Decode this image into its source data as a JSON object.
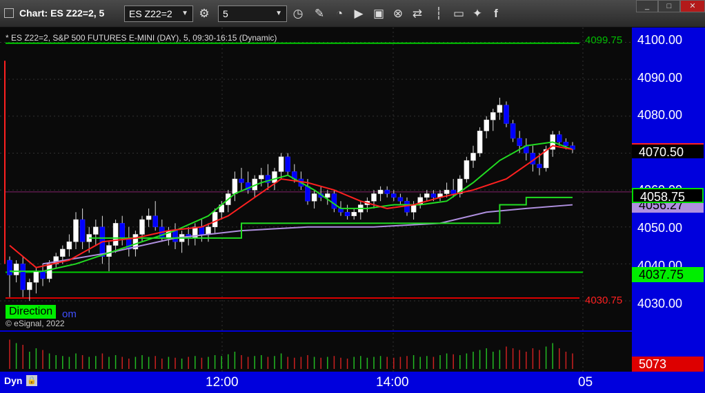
{
  "window": {
    "title": "Chart: ES Z22=2, 5",
    "symbol_value": "ES Z22=2",
    "interval_value": "5",
    "btn_minimize": "_",
    "btn_maximize": "□",
    "btn_close": "✕"
  },
  "toolbar": {
    "icons": [
      "settings-icon",
      "clock-icon",
      "pencil-icon",
      "chart-line-icon",
      "play-icon",
      "text-box-icon",
      "target-icon",
      "swap-icon",
      "bar-icon",
      "comment-icon",
      "twitter-icon",
      "facebook-icon"
    ]
  },
  "chart": {
    "header": "* ES Z22=2, S&P 500 FUTURES E-MINI (DAY), 5, 09:30-16:15 (Dynamic)",
    "level_top": "4099.75",
    "level_bottom": "4030.75",
    "direction_label": "Direction",
    "fragment_text": "om",
    "copyright": "© eSignal, 2022",
    "price_labels": [
      "4100.00",
      "4090.00",
      "4080.00",
      "4070.50",
      "4060.00",
      "4050.00",
      "4040.00",
      "4030.00"
    ],
    "tag_last": "4070.50",
    "tag_green": "4058.75",
    "tag_purple": "4056.27",
    "tag_direction": "4037.75",
    "volume_tag": "5073",
    "bottom_left": "Dyn",
    "time_labels": [
      "12:00",
      "14:00",
      "05"
    ]
  },
  "colors": {
    "price_axis": "#0000dd",
    "up_candle": "#ffffff",
    "down_candle": "#0000ff",
    "ma_red": "#ff2020",
    "ma_green": "#22dd22",
    "ma_purple": "#b090e0",
    "level_green": "#00cc00",
    "level_red": "#dd0000"
  },
  "chart_data": {
    "type": "candlestick",
    "ylim": [
      4022,
      4104
    ],
    "candles": [
      [
        4041,
        4042,
        4031,
        4037
      ],
      [
        4037,
        4041,
        4035,
        4040
      ],
      [
        4040,
        4042,
        4031,
        4033
      ],
      [
        4033,
        4036,
        4030,
        4035
      ],
      [
        4035,
        4039,
        4032,
        4038
      ],
      [
        4038,
        4040,
        4034,
        4036
      ],
      [
        4036,
        4041,
        4035,
        4040
      ],
      [
        4040,
        4043,
        4039,
        4042
      ],
      [
        4042,
        4045,
        4040,
        4044
      ],
      [
        4044,
        4048,
        4042,
        4046
      ],
      [
        4046,
        4054,
        4044,
        4052
      ],
      [
        4052,
        4055,
        4044,
        4046
      ],
      [
        4046,
        4050,
        4043,
        4048
      ],
      [
        4048,
        4052,
        4045,
        4050
      ],
      [
        4050,
        4053,
        4040,
        4042
      ],
      [
        4042,
        4046,
        4038,
        4045
      ],
      [
        4045,
        4052,
        4043,
        4051
      ],
      [
        4051,
        4053,
        4045,
        4047
      ],
      [
        4047,
        4050,
        4042,
        4044
      ],
      [
        4044,
        4049,
        4042,
        4048
      ],
      [
        4048,
        4053,
        4046,
        4052
      ],
      [
        4052,
        4055,
        4050,
        4053
      ],
      [
        4053,
        4057,
        4049,
        4050
      ],
      [
        4050,
        4052,
        4046,
        4047
      ],
      [
        4047,
        4050,
        4045,
        4049
      ],
      [
        4049,
        4051,
        4044,
        4046
      ],
      [
        4046,
        4049,
        4043,
        4048
      ],
      [
        4048,
        4050,
        4045,
        4047
      ],
      [
        4047,
        4051,
        4045,
        4050
      ],
      [
        4050,
        4052,
        4046,
        4048
      ],
      [
        4048,
        4051,
        4046,
        4050
      ],
      [
        4050,
        4055,
        4048,
        4054
      ],
      [
        4054,
        4057,
        4052,
        4056
      ],
      [
        4056,
        4060,
        4054,
        4059
      ],
      [
        4059,
        4065,
        4057,
        4063
      ],
      [
        4063,
        4066,
        4060,
        4062
      ],
      [
        4062,
        4065,
        4059,
        4060
      ],
      [
        4060,
        4064,
        4058,
        4063
      ],
      [
        4063,
        4066,
        4061,
        4064
      ],
      [
        4064,
        4067,
        4060,
        4062
      ],
      [
        4062,
        4066,
        4060,
        4065
      ],
      [
        4065,
        4070,
        4063,
        4069
      ],
      [
        4069,
        4070,
        4064,
        4065
      ],
      [
        4065,
        4067,
        4062,
        4063
      ],
      [
        4063,
        4065,
        4060,
        4061
      ],
      [
        4061,
        4063,
        4056,
        4057
      ],
      [
        4057,
        4060,
        4055,
        4059
      ],
      [
        4059,
        4061,
        4057,
        4058
      ],
      [
        4058,
        4060,
        4056,
        4059
      ],
      [
        4059,
        4060,
        4054,
        4055
      ],
      [
        4055,
        4057,
        4053,
        4054
      ],
      [
        4054,
        4056,
        4052,
        4053
      ],
      [
        4053,
        4055,
        4052,
        4054
      ],
      [
        4054,
        4057,
        4052,
        4056
      ],
      [
        4056,
        4058,
        4054,
        4057
      ],
      [
        4057,
        4060,
        4055,
        4059
      ],
      [
        4059,
        4061,
        4057,
        4060
      ],
      [
        4060,
        4061,
        4058,
        4059
      ],
      [
        4059,
        4060,
        4057,
        4058
      ],
      [
        4058,
        4059,
        4056,
        4057
      ],
      [
        4057,
        4058,
        4053,
        4054
      ],
      [
        4054,
        4057,
        4052,
        4056
      ],
      [
        4056,
        4059,
        4055,
        4058
      ],
      [
        4058,
        4060,
        4057,
        4059
      ],
      [
        4059,
        4060,
        4057,
        4058
      ],
      [
        4058,
        4060,
        4057,
        4059
      ],
      [
        4059,
        4062,
        4058,
        4060
      ],
      [
        4060,
        4063,
        4058,
        4059
      ],
      [
        4059,
        4064,
        4058,
        4063
      ],
      [
        4063,
        4069,
        4062,
        4068
      ],
      [
        4068,
        4072,
        4066,
        4070
      ],
      [
        4070,
        4077,
        4069,
        4076
      ],
      [
        4076,
        4080,
        4074,
        4079
      ],
      [
        4079,
        4082,
        4076,
        4081
      ],
      [
        4081,
        4085,
        4079,
        4083
      ],
      [
        4083,
        4084,
        4077,
        4078
      ],
      [
        4078,
        4079,
        4073,
        4074
      ],
      [
        4074,
        4076,
        4070,
        4072
      ],
      [
        4072,
        4074,
        4068,
        4070
      ],
      [
        4070,
        4072,
        4065,
        4067
      ],
      [
        4067,
        4070,
        4064,
        4066
      ],
      [
        4066,
        4072,
        4065,
        4071
      ],
      [
        4071,
        4076,
        4069,
        4075
      ],
      [
        4075,
        4076,
        4072,
        4073
      ],
      [
        4073,
        4074,
        4071,
        4072
      ],
      [
        4072,
        4073,
        4070,
        4071
      ]
    ],
    "ma_red": [
      [
        0,
        4045
      ],
      [
        4,
        4039
      ],
      [
        9,
        4041
      ],
      [
        14,
        4046
      ],
      [
        19,
        4047
      ],
      [
        24,
        4049
      ],
      [
        29,
        4050
      ],
      [
        33,
        4053
      ],
      [
        37,
        4058
      ],
      [
        41,
        4063
      ],
      [
        45,
        4062
      ],
      [
        49,
        4060
      ],
      [
        53,
        4057
      ],
      [
        57,
        4055
      ],
      [
        61,
        4056
      ],
      [
        65,
        4058
      ],
      [
        70,
        4060
      ],
      [
        75,
        4063
      ],
      [
        79,
        4068
      ],
      [
        82,
        4072
      ],
      [
        85,
        4071
      ]
    ],
    "ma_green": [
      [
        0,
        4038
      ],
      [
        5,
        4038
      ],
      [
        10,
        4040
      ],
      [
        15,
        4043
      ],
      [
        20,
        4046
      ],
      [
        25,
        4049
      ],
      [
        30,
        4053
      ],
      [
        34,
        4059
      ],
      [
        38,
        4062
      ],
      [
        42,
        4064
      ],
      [
        46,
        4060
      ],
      [
        50,
        4055
      ],
      [
        54,
        4055
      ],
      [
        58,
        4056
      ],
      [
        62,
        4056
      ],
      [
        66,
        4057
      ],
      [
        70,
        4062
      ],
      [
        74,
        4068
      ],
      [
        78,
        4072
      ],
      [
        82,
        4073
      ],
      [
        85,
        4071
      ]
    ],
    "green_step": [
      [
        12,
        4047
      ],
      [
        35,
        4051
      ],
      [
        70,
        4051
      ],
      [
        74,
        4056
      ],
      [
        78,
        4058
      ],
      [
        85,
        4058
      ]
    ],
    "ma_purple": [
      [
        5,
        4040
      ],
      [
        15,
        4043
      ],
      [
        25,
        4047
      ],
      [
        35,
        4049
      ],
      [
        45,
        4050
      ],
      [
        55,
        4050
      ],
      [
        65,
        4051
      ],
      [
        72,
        4054
      ],
      [
        78,
        4055
      ],
      [
        85,
        4056
      ]
    ],
    "volume": [
      34,
      30,
      28,
      20,
      24,
      22,
      18,
      16,
      15,
      14,
      18,
      16,
      14,
      15,
      18,
      14,
      16,
      14,
      12,
      14,
      16,
      14,
      15,
      12,
      14,
      13,
      12,
      14,
      15,
      13,
      14,
      16,
      15,
      17,
      20,
      16,
      14,
      15,
      16,
      14,
      15,
      18,
      14,
      13,
      14,
      16,
      14,
      13,
      14,
      15,
      13,
      12,
      14,
      15,
      13,
      14,
      15,
      14,
      13,
      14,
      15,
      16,
      14,
      15,
      14,
      16,
      18,
      17,
      16,
      18,
      20,
      22,
      24,
      20,
      22,
      26,
      24,
      22,
      20,
      24,
      22,
      26,
      30,
      24,
      20,
      18
    ]
  }
}
